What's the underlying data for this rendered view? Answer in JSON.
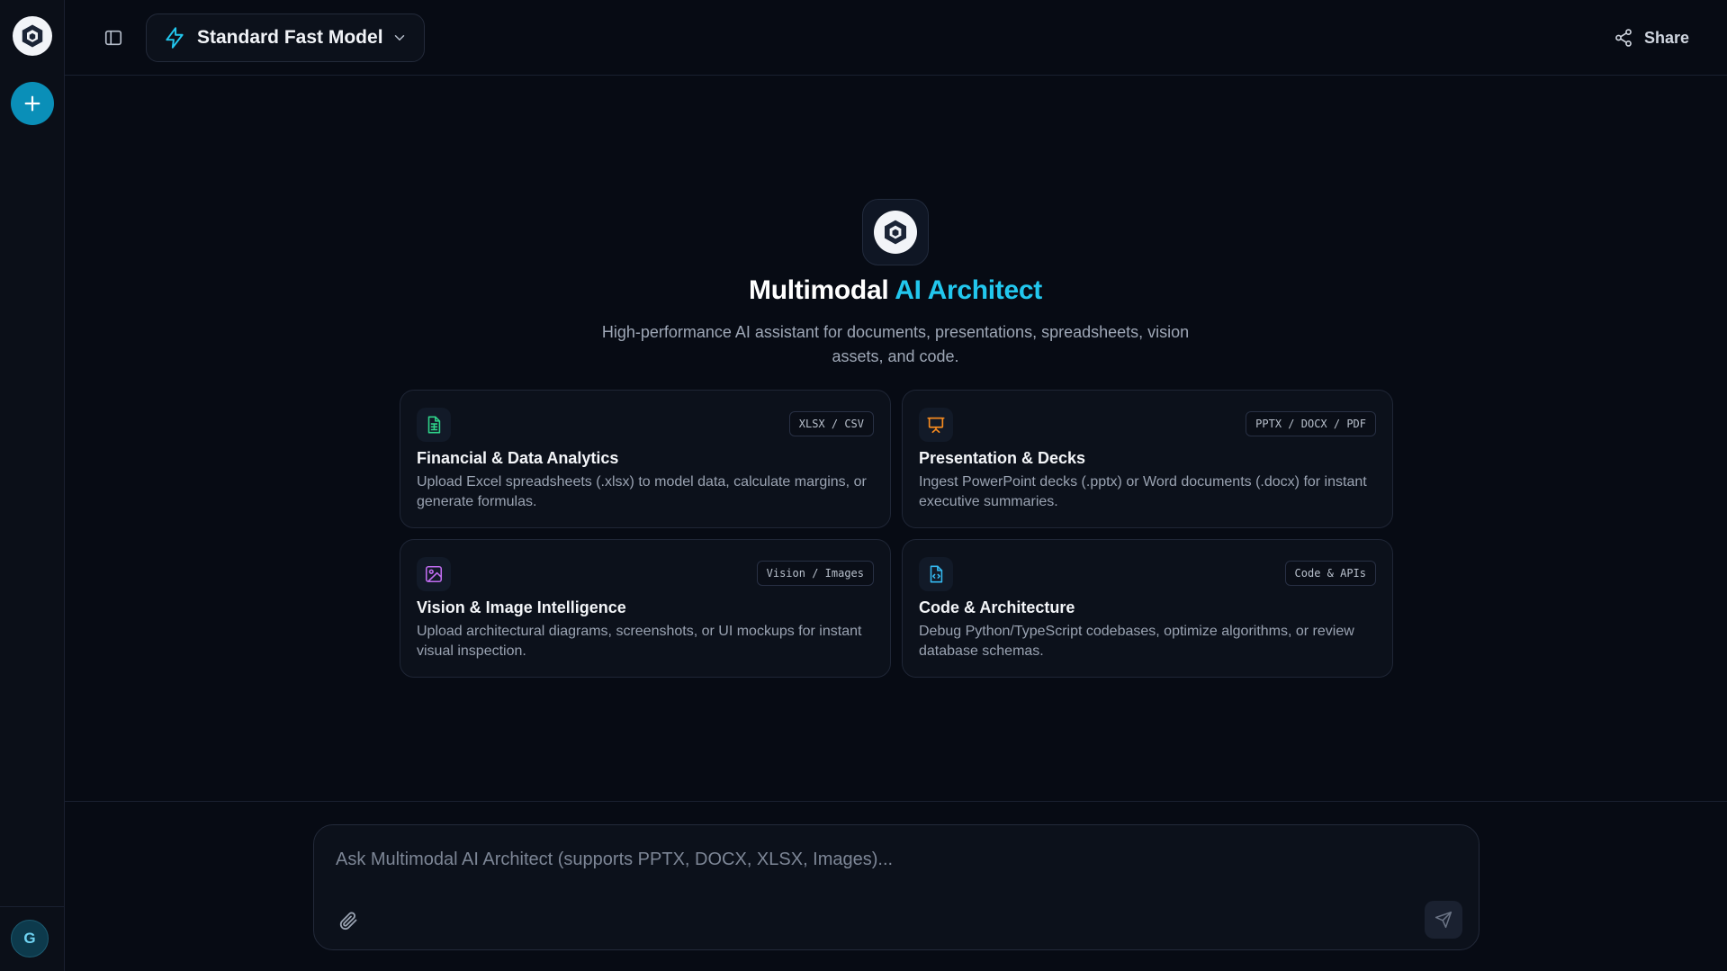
{
  "header": {
    "model_label": "Standard Fast Model",
    "share_label": "Share"
  },
  "rail": {
    "avatar_initial": "G"
  },
  "hero": {
    "title_main": "Multimodal",
    "title_accent": "AI Architect",
    "subtitle": "High-performance AI assistant for documents, presentations, spreadsheets, vision assets, and code."
  },
  "cards": [
    {
      "title": "Financial & Data Analytics",
      "tag": "XLSX / CSV",
      "description": "Upload Excel spreadsheets (.xlsx) to model data, calculate margins, or generate formulas.",
      "icon": "spreadsheet-icon",
      "icon_color": "#2fd48a"
    },
    {
      "title": "Presentation & Decks",
      "tag": "PPTX / DOCX / PDF",
      "description": "Ingest PowerPoint decks (.pptx) or Word documents (.docx) for instant executive summaries.",
      "icon": "presentation-icon",
      "icon_color": "#f58a1f"
    },
    {
      "title": "Vision & Image Intelligence",
      "tag": "Vision / Images",
      "description": "Upload architectural diagrams, screenshots, or UI mockups for instant visual inspection.",
      "icon": "image-icon",
      "icon_color": "#c06cf0"
    },
    {
      "title": "Code & Architecture",
      "tag": "Code & APIs",
      "description": "Debug Python/TypeScript codebases, optimize algorithms, or review database schemas.",
      "icon": "code-file-icon",
      "icon_color": "#34b8f0"
    }
  ],
  "composer": {
    "placeholder": "Ask Multimodal AI Architect (supports PPTX, DOCX, XLSX, Images)...",
    "value": ""
  },
  "colors": {
    "background": "#070b14",
    "accent": "#22c7ee",
    "new_button": "#0a8fb8"
  }
}
